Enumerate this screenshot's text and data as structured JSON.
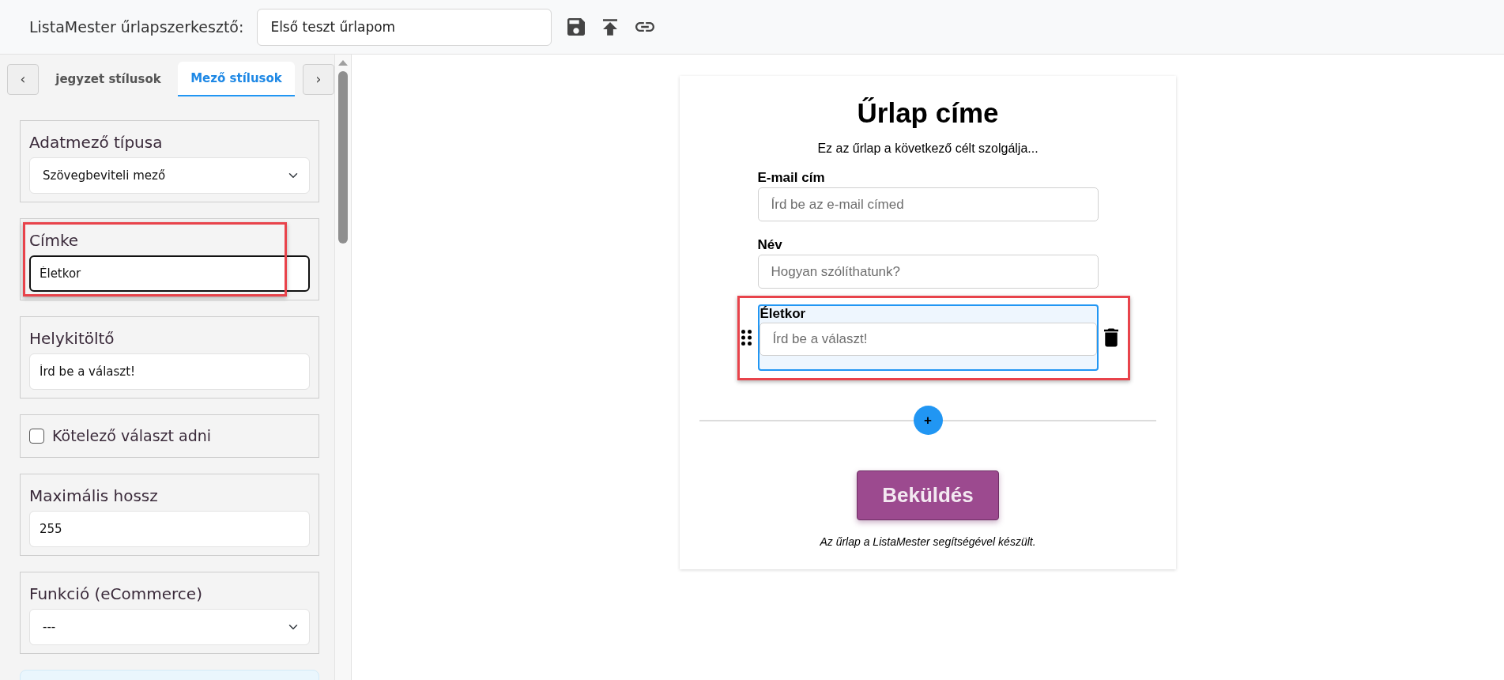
{
  "app": {
    "title": "ListaMester űrlapszerkesztő:",
    "form_name": "Első teszt űrlapom"
  },
  "sidebar": {
    "prev_button": "‹",
    "next_button": "›",
    "tabs": [
      {
        "label": "jegyzet stílusok",
        "selected": false
      },
      {
        "label": "Mező stílusok",
        "selected": true
      }
    ],
    "sections": [
      {
        "kind": "select",
        "label": "Adatmező típusa",
        "value": "Szövegbeviteli mező",
        "focused": false,
        "annotated": false
      },
      {
        "kind": "input",
        "label": "Címke",
        "value": "Életkor",
        "focused": true,
        "annotated": true
      },
      {
        "kind": "input",
        "label": "Helykitöltő",
        "value": "Írd be a választ!",
        "focused": false,
        "annotated": false
      },
      {
        "kind": "checkbox",
        "label": "Kötelező választ adni",
        "checked": false,
        "annotated": false
      },
      {
        "kind": "input",
        "label": "Maximális hossz",
        "value": "255",
        "focused": false,
        "annotated": false
      },
      {
        "kind": "select",
        "label": "Funkció (eCommerce)",
        "value": "---",
        "focused": false,
        "annotated": false
      },
      {
        "kind": "info"
      }
    ]
  },
  "form": {
    "title": "Űrlap címe",
    "description": "Ez az űrlap a következő célt szolgálja...",
    "fields": [
      {
        "label": "E-mail cím",
        "placeholder": "Írd be az e-mail címed",
        "selected": false,
        "annotated": false
      },
      {
        "label": "Név",
        "placeholder": "Hogyan szólíthatunk?",
        "selected": false,
        "annotated": false
      },
      {
        "label": "Életkor",
        "placeholder": "Írd be a választ!",
        "selected": true,
        "annotated": true
      }
    ],
    "add_button": "+",
    "submit_button": "Beküldés",
    "footer": "Az űrlap a ListaMester segítségével készült."
  }
}
